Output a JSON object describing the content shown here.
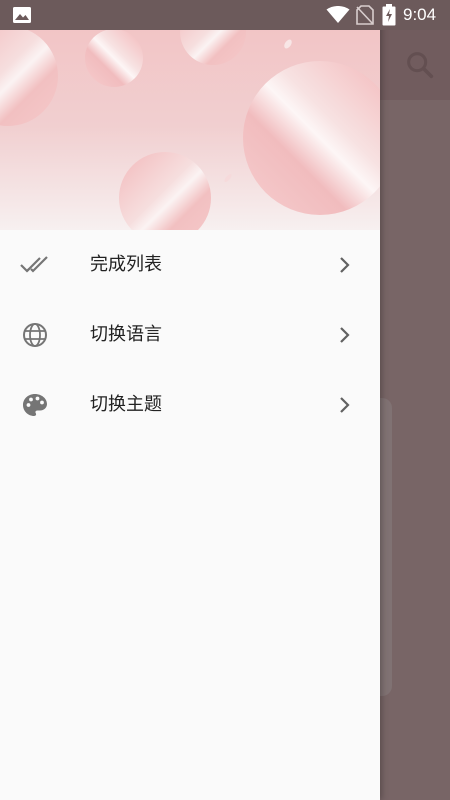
{
  "status_bar": {
    "time": "9:04",
    "icons": [
      "image-notification-icon",
      "wifi-icon",
      "no-sim-icon",
      "battery-charging-icon"
    ]
  },
  "app": {
    "toolbar_icons": [
      "search-icon"
    ]
  },
  "drawer": {
    "menu": [
      {
        "label": "完成列表",
        "icon": "double-check-icon"
      },
      {
        "label": "切换语言",
        "icon": "globe-icon"
      },
      {
        "label": "切换主题",
        "icon": "palette-icon"
      }
    ]
  },
  "colors": {
    "header_pink": "#f4c6c7",
    "scrim": "#6f5a5b",
    "drawer_bg": "#fafafa",
    "icon_gray": "#757575"
  }
}
